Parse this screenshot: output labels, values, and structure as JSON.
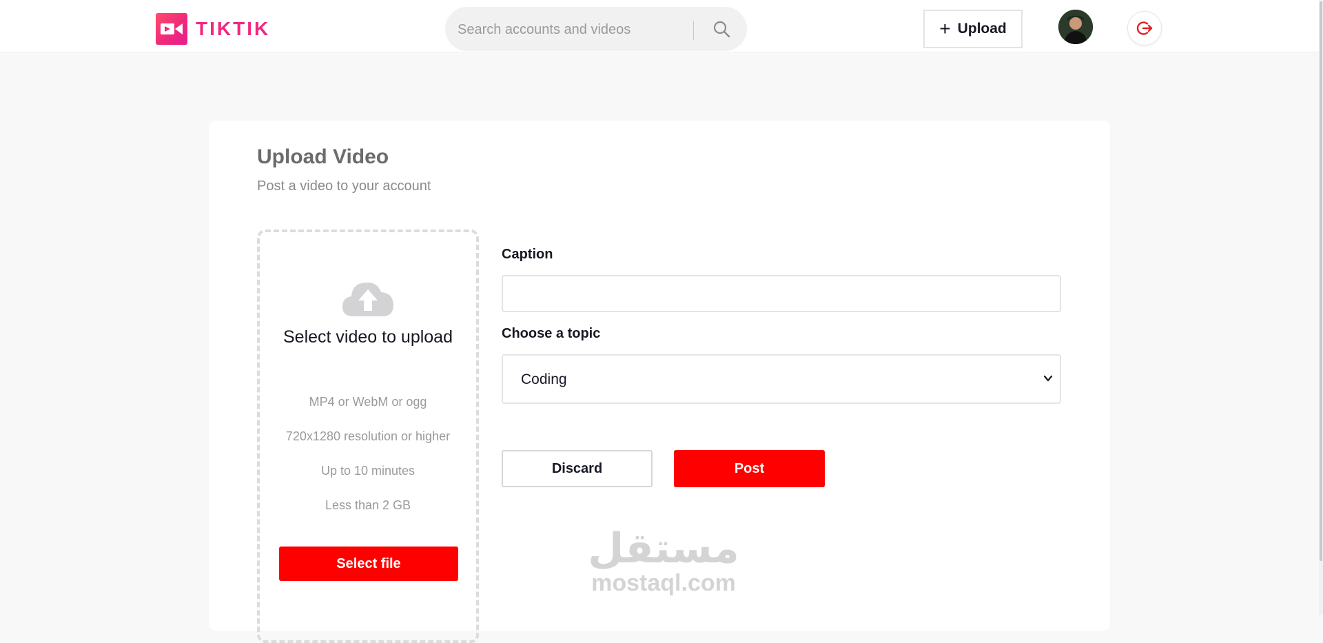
{
  "app": {
    "logo_text": "TIKTIK",
    "brand_color": "#f0287f",
    "accent_color": "#ff0000"
  },
  "header": {
    "search": {
      "placeholder": "Search accounts and videos",
      "value": "",
      "icon": "search-icon"
    },
    "upload_label": "Upload",
    "logout_icon": "logout-icon",
    "avatar": "user-avatar"
  },
  "upload_page": {
    "title": "Upload Video",
    "subtitle": "Post a video to your account",
    "dropzone": {
      "icon": "cloud-upload-icon",
      "heading": "Select video to upload",
      "specs": [
        "MP4 or WebM or ogg",
        "720x1280 resolution or higher",
        "Up to 10 minutes",
        "Less than 2 GB"
      ],
      "button_label": "Select file"
    },
    "form": {
      "caption_label": "Caption",
      "caption_value": "",
      "topic_label": "Choose a topic",
      "topic_value": "Coding",
      "discard_label": "Discard",
      "post_label": "Post"
    }
  },
  "watermark": {
    "arabic": "مستقل",
    "latin": "mostaql.com"
  }
}
